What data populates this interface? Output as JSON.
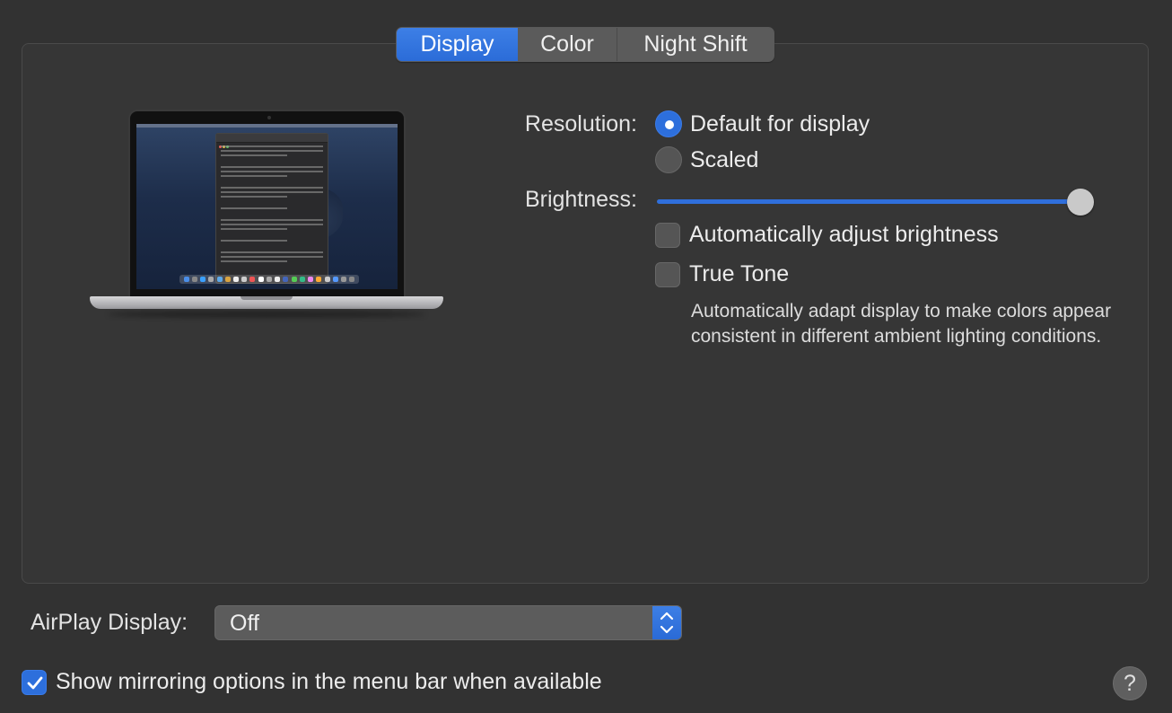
{
  "tabs": [
    {
      "label": "Display",
      "selected": true
    },
    {
      "label": "Color",
      "selected": false
    },
    {
      "label": "Night Shift",
      "selected": false
    }
  ],
  "display": {
    "resolution_label": "Resolution:",
    "resolution_options": [
      {
        "label": "Default for display",
        "selected": true
      },
      {
        "label": "Scaled",
        "selected": false
      }
    ],
    "brightness_label": "Brightness:",
    "brightness_level": 1.0,
    "auto_brightness": {
      "label": "Automatically adjust brightness",
      "checked": false
    },
    "true_tone": {
      "label": "True Tone",
      "checked": false
    },
    "true_tone_description": "Automatically adapt display to make colors appear consistent in different ambient lighting conditions."
  },
  "airplay": {
    "label": "AirPlay Display:",
    "value": "Off"
  },
  "mirroring": {
    "label": "Show mirroring options in the menu bar when available",
    "checked": true
  },
  "help": {
    "label": "?"
  },
  "colors": {
    "accent": "#2d6fdc",
    "background": "#323232"
  }
}
